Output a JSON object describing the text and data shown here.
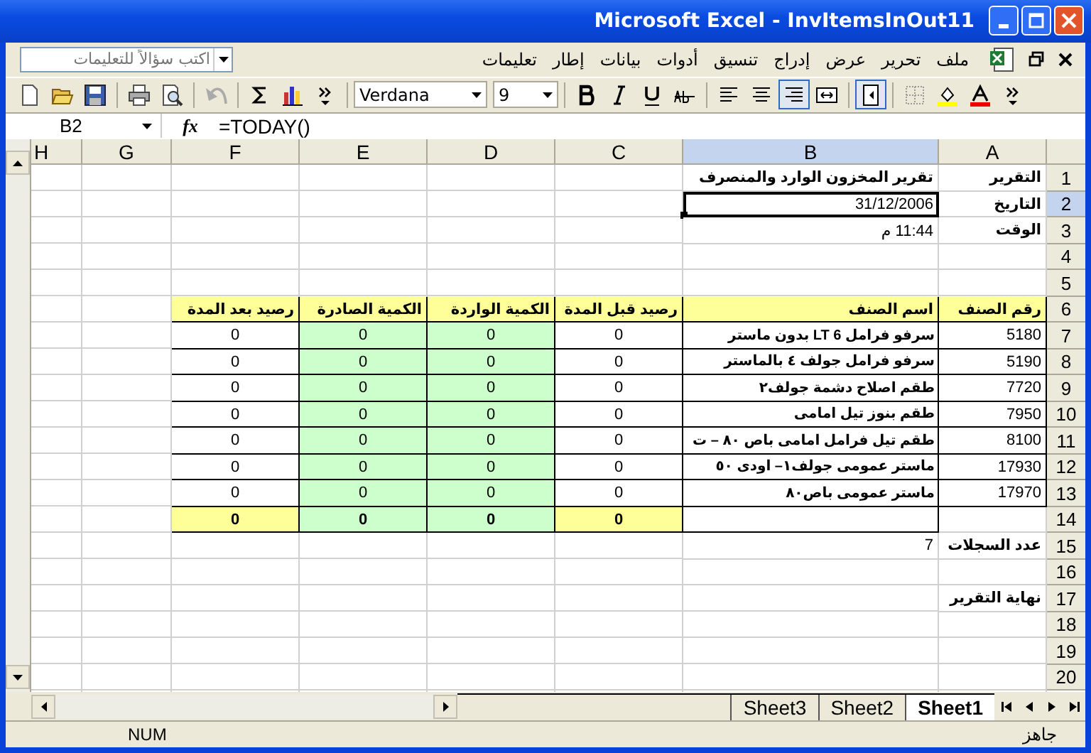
{
  "window": {
    "title": "Microsoft Excel - InvItemsInOut11"
  },
  "menu": {
    "items": [
      "ملف",
      "تحرير",
      "عرض",
      "إدراج",
      "تنسيق",
      "أدوات",
      "بيانات",
      "إطار",
      "تعليمات"
    ],
    "help_box": {
      "placeholder": "اكتب سؤالاً للتعليمات"
    }
  },
  "toolbar": {
    "groups": [
      [
        {
          "kind": "more"
        },
        {
          "kind": "font_color"
        },
        {
          "kind": "fill"
        },
        {
          "kind": "borders"
        }
      ],
      [
        {
          "kind": "direction",
          "pressed": true
        }
      ],
      [
        {
          "kind": "merge",
          "pressed": false
        },
        {
          "kind": "align_right",
          "pressed": true
        },
        {
          "kind": "align_center",
          "pressed": false
        },
        {
          "kind": "align_left",
          "pressed": false
        }
      ],
      [
        {
          "kind": "strike"
        },
        {
          "kind": "underline"
        },
        {
          "kind": "italic"
        },
        {
          "kind": "bold"
        }
      ],
      [
        {
          "kind": "size",
          "value": "9"
        },
        {
          "kind": "font",
          "value": "Verdana"
        }
      ],
      [
        {
          "kind": "more"
        },
        {
          "kind": "chart"
        },
        {
          "kind": "sum"
        }
      ],
      [
        {
          "kind": "undo",
          "disabled": true
        }
      ],
      [
        {
          "kind": "preview"
        },
        {
          "kind": "print"
        }
      ],
      [
        {
          "kind": "save"
        },
        {
          "kind": "open"
        },
        {
          "kind": "new"
        }
      ]
    ]
  },
  "formula_bar": {
    "name_box": "B2",
    "fx": "fx",
    "formula": "=TODAY()"
  },
  "sheet": {
    "columns": [
      {
        "label": "A",
        "selected": false
      },
      {
        "label": "B",
        "selected": true
      },
      {
        "label": "C",
        "selected": false
      },
      {
        "label": "D",
        "selected": false
      },
      {
        "label": "E",
        "selected": false
      },
      {
        "label": "F",
        "selected": false
      },
      {
        "label": "G",
        "selected": false
      },
      {
        "label": "H",
        "selected": false
      }
    ],
    "rows": [
      {
        "label": "1",
        "selected": false,
        "cells": [
          {
            "kind": "label",
            "text": "التقرير"
          },
          {
            "kind": "label",
            "text": "تقرير المخزون الوارد والمنصرف"
          }
        ]
      },
      {
        "label": "2",
        "selected": true,
        "cells": [
          {
            "kind": "label",
            "text": "التاريخ"
          },
          {
            "kind": "plain",
            "text": "31/12/2006"
          }
        ]
      },
      {
        "label": "3",
        "selected": false,
        "cells": [
          {
            "kind": "label",
            "text": "الوقت"
          },
          {
            "kind": "plain",
            "text": "11:44 م"
          }
        ]
      },
      {
        "label": "4",
        "selected": false
      },
      {
        "label": "5",
        "selected": false
      },
      {
        "label": "6",
        "selected": false,
        "cells": [
          {
            "kind": "head",
            "text": "رقم الصنف"
          },
          {
            "kind": "head",
            "text": "اسم الصنف"
          },
          {
            "kind": "head",
            "text": "رصيد قبل المدة"
          },
          {
            "kind": "head",
            "text": "الكمية الواردة"
          },
          {
            "kind": "head",
            "text": "الكمية الصادرة"
          },
          {
            "kind": "head",
            "text": "رصيد بعد المدة"
          }
        ]
      },
      {
        "label": "7",
        "selected": false,
        "cells": [
          {
            "kind": "code",
            "text": "5180"
          },
          {
            "kind": "item",
            "text": "سرفو فرامل LT 6  بدون ماستر"
          },
          {
            "kind": "zero",
            "text": "0"
          },
          {
            "kind": "zero_in",
            "text": "0"
          },
          {
            "kind": "zero_in",
            "text": "0"
          },
          {
            "kind": "zero",
            "text": "0"
          }
        ]
      },
      {
        "label": "8",
        "selected": false,
        "cells": [
          {
            "kind": "code",
            "text": "5190"
          },
          {
            "kind": "item",
            "text": "سرفو فرامل  جولف ٤  بالماستر"
          },
          {
            "kind": "zero",
            "text": "0"
          },
          {
            "kind": "zero_in",
            "text": "0"
          },
          {
            "kind": "zero_in",
            "text": "0"
          },
          {
            "kind": "zero",
            "text": "0"
          }
        ]
      },
      {
        "label": "9",
        "selected": false,
        "cells": [
          {
            "kind": "code",
            "text": "7720"
          },
          {
            "kind": "item",
            "text": "طقم اصلاح دشمة جولف٢"
          },
          {
            "kind": "zero",
            "text": "0"
          },
          {
            "kind": "zero_in",
            "text": "0"
          },
          {
            "kind": "zero_in",
            "text": "0"
          },
          {
            "kind": "zero",
            "text": "0"
          }
        ]
      },
      {
        "label": "10",
        "selected": false,
        "cells": [
          {
            "kind": "code",
            "text": "7950"
          },
          {
            "kind": "item",
            "text": "طقم بنوز تيل امامى"
          },
          {
            "kind": "zero",
            "text": "0"
          },
          {
            "kind": "zero_in",
            "text": "0"
          },
          {
            "kind": "zero_in",
            "text": "0"
          },
          {
            "kind": "zero",
            "text": "0"
          }
        ]
      },
      {
        "label": "11",
        "selected": false,
        "cells": [
          {
            "kind": "code",
            "text": "8100"
          },
          {
            "kind": "item",
            "text": "طقم تيل فرامل امامى باص ٨٠ – ت"
          },
          {
            "kind": "zero",
            "text": "0"
          },
          {
            "kind": "zero_in",
            "text": "0"
          },
          {
            "kind": "zero_in",
            "text": "0"
          },
          {
            "kind": "zero",
            "text": "0"
          }
        ]
      },
      {
        "label": "12",
        "selected": false,
        "cells": [
          {
            "kind": "code",
            "text": "17930"
          },
          {
            "kind": "item",
            "text": "ماستر عمومى  جولف١– اودى ٥٠"
          },
          {
            "kind": "zero",
            "text": "0"
          },
          {
            "kind": "zero_in",
            "text": "0"
          },
          {
            "kind": "zero_in",
            "text": "0"
          },
          {
            "kind": "zero",
            "text": "0"
          }
        ]
      },
      {
        "label": "13",
        "selected": false,
        "cells": [
          {
            "kind": "code",
            "text": "17970"
          },
          {
            "kind": "item",
            "text": "ماستر عمومى باص٨٠"
          },
          {
            "kind": "zero",
            "text": "0"
          },
          {
            "kind": "zero_in",
            "text": "0"
          },
          {
            "kind": "zero_in",
            "text": "0"
          },
          {
            "kind": "zero",
            "text": "0"
          }
        ]
      },
      {
        "label": "14",
        "selected": false,
        "cells": [
          null,
          {
            "kind": "box"
          },
          {
            "kind": "total",
            "text": "0"
          },
          {
            "kind": "total_in",
            "text": "0"
          },
          {
            "kind": "total_in",
            "text": "0"
          },
          {
            "kind": "total",
            "text": "0"
          }
        ]
      },
      {
        "label": "15",
        "selected": false,
        "cells": [
          {
            "kind": "label",
            "text": "عدد السجلات"
          },
          {
            "kind": "plain",
            "text": "7"
          }
        ]
      },
      {
        "label": "16",
        "selected": false
      },
      {
        "label": "17",
        "selected": false,
        "cells": [
          {
            "kind": "label",
            "text": "نهاية التقرير"
          }
        ]
      },
      {
        "label": "18",
        "selected": false
      },
      {
        "label": "19",
        "selected": false
      },
      {
        "label": "20",
        "selected": false
      }
    ]
  },
  "sheet_tabs": [
    {
      "label": "Sheet1",
      "selected": true
    },
    {
      "label": "Sheet2",
      "selected": false
    },
    {
      "label": "Sheet3",
      "selected": false
    }
  ],
  "status_bar": {
    "state": "جاهز",
    "num": "NUM"
  }
}
